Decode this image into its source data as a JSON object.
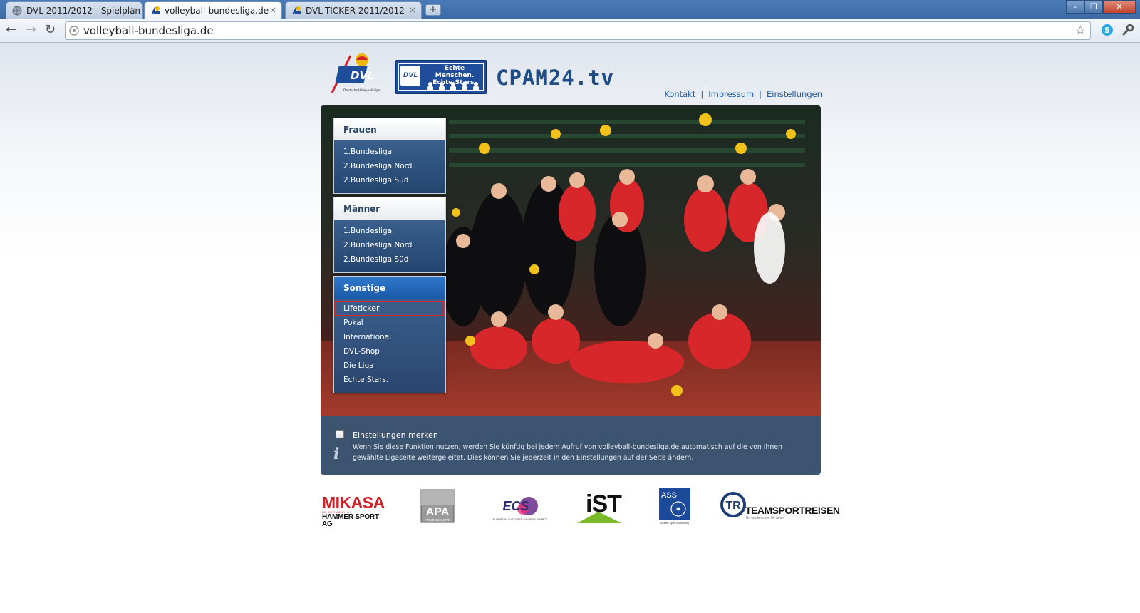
{
  "browser": {
    "tabs": [
      {
        "title": "DVL 2011/2012 - Spielplan",
        "active": false
      },
      {
        "title": "volleyball-bundesliga.de",
        "active": true
      },
      {
        "title": "DVL-TICKER 2011/2012",
        "active": false
      }
    ],
    "new_tab_label": "+",
    "close_tab_label": "×",
    "url": "volleyball-bundesliga.de",
    "window_buttons": {
      "minimize": "–",
      "maximize": "❐",
      "close": "✕"
    },
    "nav": {
      "back": "←",
      "forward": "→",
      "reload": "↻",
      "bookmark": "☆"
    }
  },
  "header": {
    "links": [
      "Kontakt",
      "Impressum",
      "Einstellungen"
    ],
    "link_separator": "|",
    "logo_cpam_text": "CPAM24.tv",
    "logo_echte_text": "Echte Menschen. Echte Stars.",
    "logo_dvl_text": "DVL",
    "logo_dvl_sub": "Deutsche Volleyball Liga"
  },
  "menu": {
    "frauen": {
      "title": "Frauen",
      "items": [
        "1.Bundesliga",
        "2.Bundesliga Nord",
        "2.Bundesliga Süd"
      ]
    },
    "maenner": {
      "title": "Männer",
      "items": [
        "1.Bundesliga",
        "2.Bundesliga Nord",
        "2.Bundesliga Süd"
      ]
    },
    "sonstige": {
      "title": "Sonstige",
      "items": [
        "Lifeticker",
        "Pokal",
        "International",
        "DVL-Shop",
        "Die Liga",
        "Echte Stars."
      ],
      "highlighted": "Lifeticker"
    }
  },
  "info": {
    "checkbox_label": "Einstellungen merken",
    "checked": false,
    "icon": "i",
    "description": "Wenn Sie diese Funktion nutzen, werden Sie künftig bei jedem Aufruf von volleyball-bundesliga.de automatisch auf die von Ihnen gewählte Ligaseite weitergeleitet. Dies können Sie jederzeit in den Einstellungen auf der Seite ändern."
  },
  "sponsors": {
    "mikasa": {
      "name": "MIKASA",
      "tagline": "IN GERMANY BY",
      "sub": "HAMMER SPORT AG"
    },
    "apa": {
      "name": "APA",
      "sub": "FIRMENGRUPPE"
    },
    "ecs": {
      "name": "ECS",
      "sub": "EUROPEAN CUSTOMER SYNERGY SOURCE"
    },
    "ist": {
      "name": "iST"
    },
    "ass": {
      "name": "ASS",
      "sub": "Athletic Sport Sponsoring"
    },
    "tsr": {
      "name": "TEAMSPORTREISEN",
      "mark": "TR",
      "sub": "Mit uns kommen Sie weiter"
    }
  },
  "colors": {
    "tab_bar": "#3b6aa4",
    "menu_blue": "#1b5aa8",
    "info_bg": "#3d5470",
    "link": "#1d5aa0",
    "highlight": "#d8282c"
  }
}
